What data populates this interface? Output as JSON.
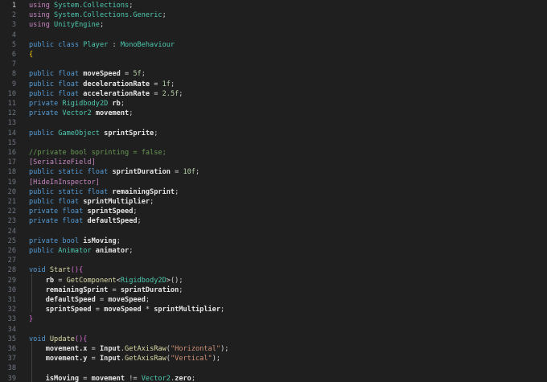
{
  "editor": {
    "active_line": 1,
    "lines": [
      {
        "n": "1",
        "tokens": [
          {
            "t": "using ",
            "c": "kw2"
          },
          {
            "t": "System.Collections",
            "c": "ty"
          },
          {
            "t": ";",
            "c": "pu"
          }
        ]
      },
      {
        "n": "2",
        "tokens": [
          {
            "t": "using ",
            "c": "kw2"
          },
          {
            "t": "System.Collections.Generic",
            "c": "ty"
          },
          {
            "t": ";",
            "c": "pu"
          }
        ]
      },
      {
        "n": "3",
        "tokens": [
          {
            "t": "using ",
            "c": "kw2"
          },
          {
            "t": "UnityEngine",
            "c": "ty"
          },
          {
            "t": ";",
            "c": "pu"
          }
        ]
      },
      {
        "n": "4",
        "tokens": []
      },
      {
        "n": "5",
        "tokens": [
          {
            "t": "public ",
            "c": "kw"
          },
          {
            "t": "class ",
            "c": "kw"
          },
          {
            "t": "Player",
            "c": "ty"
          },
          {
            "t": " : ",
            "c": "pu"
          },
          {
            "t": "MonoBehaviour",
            "c": "ty"
          }
        ]
      },
      {
        "n": "6",
        "tokens": [
          {
            "t": "{",
            "c": "br"
          }
        ]
      },
      {
        "n": "7",
        "tokens": []
      },
      {
        "n": "8",
        "tokens": [
          {
            "t": "public ",
            "c": "kw"
          },
          {
            "t": "float ",
            "c": "kw"
          },
          {
            "t": "moveSpeed",
            "c": "id"
          },
          {
            "t": " = ",
            "c": "pu"
          },
          {
            "t": "5f",
            "c": "nu"
          },
          {
            "t": ";",
            "c": "pu"
          }
        ]
      },
      {
        "n": "9",
        "tokens": [
          {
            "t": "public ",
            "c": "kw"
          },
          {
            "t": "float ",
            "c": "kw"
          },
          {
            "t": "decelerationRate",
            "c": "id"
          },
          {
            "t": " = ",
            "c": "pu"
          },
          {
            "t": "1f",
            "c": "nu"
          },
          {
            "t": ";",
            "c": "pu"
          }
        ]
      },
      {
        "n": "10",
        "tokens": [
          {
            "t": "public ",
            "c": "kw"
          },
          {
            "t": "float ",
            "c": "kw"
          },
          {
            "t": "accelerationRate",
            "c": "id"
          },
          {
            "t": " = ",
            "c": "pu"
          },
          {
            "t": "2.5f",
            "c": "nu"
          },
          {
            "t": ";",
            "c": "pu"
          }
        ]
      },
      {
        "n": "11",
        "tokens": [
          {
            "t": "private ",
            "c": "kw"
          },
          {
            "t": "Rigidbody2D ",
            "c": "ty"
          },
          {
            "t": "rb",
            "c": "id"
          },
          {
            "t": ";",
            "c": "pu"
          }
        ]
      },
      {
        "n": "12",
        "tokens": [
          {
            "t": "private ",
            "c": "kw"
          },
          {
            "t": "Vector2 ",
            "c": "ty"
          },
          {
            "t": "movement",
            "c": "id"
          },
          {
            "t": ";",
            "c": "pu"
          }
        ]
      },
      {
        "n": "13",
        "tokens": []
      },
      {
        "n": "14",
        "tokens": [
          {
            "t": "public ",
            "c": "kw"
          },
          {
            "t": "GameObject ",
            "c": "ty"
          },
          {
            "t": "sprintSprite",
            "c": "id"
          },
          {
            "t": ";",
            "c": "pu"
          }
        ]
      },
      {
        "n": "15",
        "tokens": []
      },
      {
        "n": "16",
        "tokens": [
          {
            "t": "//private bool sprinting = false;",
            "c": "cm"
          }
        ]
      },
      {
        "n": "17",
        "tokens": [
          {
            "t": "[SerializeField]",
            "c": "at"
          }
        ]
      },
      {
        "n": "18",
        "tokens": [
          {
            "t": "public ",
            "c": "kw"
          },
          {
            "t": "static ",
            "c": "kw"
          },
          {
            "t": "float ",
            "c": "kw"
          },
          {
            "t": "sprintDuration",
            "c": "id"
          },
          {
            "t": " = ",
            "c": "pu"
          },
          {
            "t": "10f",
            "c": "nu"
          },
          {
            "t": ";",
            "c": "pu"
          }
        ]
      },
      {
        "n": "19",
        "tokens": [
          {
            "t": "[HideInInspector]",
            "c": "at"
          }
        ]
      },
      {
        "n": "20",
        "tokens": [
          {
            "t": "public ",
            "c": "kw"
          },
          {
            "t": "static ",
            "c": "kw"
          },
          {
            "t": "float ",
            "c": "kw"
          },
          {
            "t": "remainingSprint",
            "c": "id"
          },
          {
            "t": ";",
            "c": "pu"
          }
        ]
      },
      {
        "n": "21",
        "tokens": [
          {
            "t": "public ",
            "c": "kw"
          },
          {
            "t": "float ",
            "c": "kw"
          },
          {
            "t": "sprintMultiplier",
            "c": "id"
          },
          {
            "t": ";",
            "c": "pu"
          }
        ]
      },
      {
        "n": "22",
        "tokens": [
          {
            "t": "private ",
            "c": "kw"
          },
          {
            "t": "float ",
            "c": "kw"
          },
          {
            "t": "sprintSpeed",
            "c": "id"
          },
          {
            "t": ";",
            "c": "pu"
          }
        ]
      },
      {
        "n": "23",
        "tokens": [
          {
            "t": "private ",
            "c": "kw"
          },
          {
            "t": "float ",
            "c": "kw"
          },
          {
            "t": "defaultSpeed",
            "c": "id"
          },
          {
            "t": ";",
            "c": "pu"
          }
        ]
      },
      {
        "n": "24",
        "tokens": []
      },
      {
        "n": "25",
        "tokens": [
          {
            "t": "private ",
            "c": "kw"
          },
          {
            "t": "bool ",
            "c": "kw"
          },
          {
            "t": "isMoving",
            "c": "id"
          },
          {
            "t": ";",
            "c": "pu"
          }
        ]
      },
      {
        "n": "26",
        "tokens": [
          {
            "t": "public ",
            "c": "kw"
          },
          {
            "t": "Animator ",
            "c": "ty"
          },
          {
            "t": "animator",
            "c": "id"
          },
          {
            "t": ";",
            "c": "pu"
          }
        ]
      },
      {
        "n": "27",
        "tokens": []
      },
      {
        "n": "28",
        "tokens": [
          {
            "t": "void ",
            "c": "kw"
          },
          {
            "t": "Start",
            "c": "fn"
          },
          {
            "t": "()",
            "c": "pr"
          },
          {
            "t": "{",
            "c": "pr"
          }
        ]
      },
      {
        "n": "29",
        "tokens": [
          {
            "t": "    rb",
            "c": "id"
          },
          {
            "t": " = ",
            "c": "pu"
          },
          {
            "t": "GetComponent",
            "c": "fn"
          },
          {
            "t": "<",
            "c": "pu"
          },
          {
            "t": "Rigidbody2D",
            "c": "ty"
          },
          {
            "t": ">",
            "c": "pu"
          },
          {
            "t": "()",
            "c": "pu"
          },
          {
            "t": ";",
            "c": "pu"
          }
        ]
      },
      {
        "n": "30",
        "tokens": [
          {
            "t": "    remainingSprint",
            "c": "id"
          },
          {
            "t": " = ",
            "c": "pu"
          },
          {
            "t": "sprintDuration",
            "c": "id"
          },
          {
            "t": ";",
            "c": "pu"
          }
        ]
      },
      {
        "n": "31",
        "tokens": [
          {
            "t": "    defaultSpeed",
            "c": "id"
          },
          {
            "t": " = ",
            "c": "pu"
          },
          {
            "t": "moveSpeed",
            "c": "id"
          },
          {
            "t": ";",
            "c": "pu"
          }
        ]
      },
      {
        "n": "32",
        "tokens": [
          {
            "t": "    sprintSpeed",
            "c": "id"
          },
          {
            "t": " = ",
            "c": "pu"
          },
          {
            "t": "moveSpeed",
            "c": "id"
          },
          {
            "t": " * ",
            "c": "pu"
          },
          {
            "t": "sprintMultiplier",
            "c": "id"
          },
          {
            "t": ";",
            "c": "pu"
          }
        ]
      },
      {
        "n": "33",
        "tokens": [
          {
            "t": "}",
            "c": "pr"
          }
        ]
      },
      {
        "n": "34",
        "tokens": []
      },
      {
        "n": "35",
        "tokens": [
          {
            "t": "void ",
            "c": "kw"
          },
          {
            "t": "Update",
            "c": "fn"
          },
          {
            "t": "()",
            "c": "pr"
          },
          {
            "t": "{",
            "c": "pr"
          }
        ]
      },
      {
        "n": "36",
        "tokens": [
          {
            "t": "    movement.x",
            "c": "id"
          },
          {
            "t": " = ",
            "c": "pu"
          },
          {
            "t": "Input",
            "c": "id"
          },
          {
            "t": ".",
            "c": "pu"
          },
          {
            "t": "GetAxisRaw",
            "c": "fn"
          },
          {
            "t": "(",
            "c": "pu"
          },
          {
            "t": "\"Horizontal\"",
            "c": "st"
          },
          {
            "t": ");",
            "c": "pu"
          }
        ]
      },
      {
        "n": "37",
        "tokens": [
          {
            "t": "    movement.y",
            "c": "id"
          },
          {
            "t": " = ",
            "c": "pu"
          },
          {
            "t": "Input",
            "c": "id"
          },
          {
            "t": ".",
            "c": "pu"
          },
          {
            "t": "GetAxisRaw",
            "c": "fn"
          },
          {
            "t": "(",
            "c": "pu"
          },
          {
            "t": "\"Vertical\"",
            "c": "st"
          },
          {
            "t": ");",
            "c": "pu"
          }
        ]
      },
      {
        "n": "38",
        "tokens": []
      },
      {
        "n": "39",
        "tokens": [
          {
            "t": "    isMoving",
            "c": "id"
          },
          {
            "t": " = ",
            "c": "pu"
          },
          {
            "t": "movement",
            "c": "id"
          },
          {
            "t": " != ",
            "c": "pu"
          },
          {
            "t": "Vector2",
            "c": "ty"
          },
          {
            "t": ".",
            "c": "pu"
          },
          {
            "t": "zero",
            "c": "id"
          },
          {
            "t": ";",
            "c": "pu"
          }
        ]
      }
    ]
  }
}
